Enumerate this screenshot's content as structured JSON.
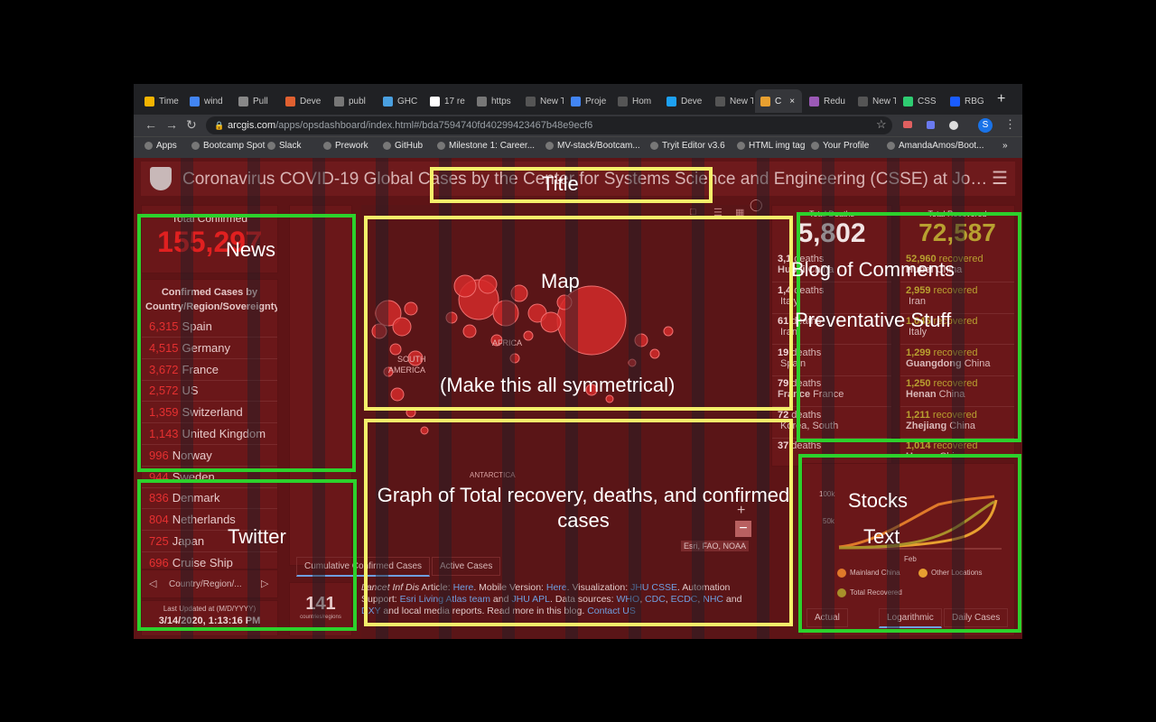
{
  "browser": {
    "tabs": [
      "Time",
      "wind",
      "Pull",
      "Deve",
      "publ",
      "GHC",
      "17 re",
      "https",
      "New Tab",
      "Proje",
      "Hom",
      "Deve",
      "New Tab",
      "C",
      "Redu",
      "New Tab",
      "CSS",
      "RBG"
    ],
    "url_host": "arcgis.com",
    "url_path": "/apps/opsdashboard/index.html#/bda7594740fd40299423467b48e9ecf6",
    "profile_initial": "S",
    "bookmarks": [
      "Apps",
      "Bootcamp Spot",
      "Slack",
      "Prework",
      "GitHub",
      "Milestone 1: Career...",
      "MV-stack/Bootcam...",
      "Tryit Editor v3.6",
      "HTML img tag",
      "Your Profile",
      "AmandaAmos/Boot..."
    ],
    "more": "»"
  },
  "dashboard": {
    "title": "Coronavirus COVID-19 Global Cases by the Center for Systems Science and Engineering (CSSE) at Jo…",
    "total_confirmed_label": "Total Confirmed",
    "total_confirmed_value": "155,297",
    "confirmed_list_header": "Confirmed Cases by Country/Region/Sovereignty",
    "confirmed_list": [
      {
        "n": "6,315",
        "c": "Spain"
      },
      {
        "n": "4,515",
        "c": "Germany"
      },
      {
        "n": "3,672",
        "c": "France"
      },
      {
        "n": "2,572",
        "c": "US"
      },
      {
        "n": "1,359",
        "c": "Switzerland"
      },
      {
        "n": "1,143",
        "c": "United Kingdom"
      },
      {
        "n": "996",
        "c": "Norway"
      },
      {
        "n": "944",
        "c": "Sweden"
      },
      {
        "n": "836",
        "c": "Denmark"
      },
      {
        "n": "804",
        "c": "Netherlands"
      },
      {
        "n": "725",
        "c": "Japan"
      },
      {
        "n": "696",
        "c": "Cruise Ship"
      }
    ],
    "pager_label": "Country/Region/...",
    "last_updated_label": "Last Updated at (M/D/YYYY)",
    "last_updated_value": "3/14/2020, 1:13:16 PM",
    "countries_count": "141",
    "countries_label": "countries/regions",
    "map_attribution": "Esri, FAO, NOAA",
    "map_labels": [
      "AFRICA",
      "SOUTH",
      "AMERICA",
      "ANTARCTICA"
    ],
    "map_tabs": [
      "Cumulative Confirmed Cases",
      "Active Cases"
    ],
    "info": {
      "p1": "Lancet Inf Dis",
      "p2": " Article: ",
      "here1": "Here",
      "p3": ". Mobile Version: ",
      "here2": "Here",
      "p4": ". Visualization: ",
      "jhu": "JHU CSSE",
      "p5": ". Automation Support: ",
      "esri": "Esri Living Atlas team",
      "p6": " and ",
      "apl": "JHU APL",
      "p7": ". Data sources: ",
      "who": "WHO",
      "cdc": "CDC",
      "ecdc": "ECDC",
      "nhc": "NHC",
      "dxy": "DXY",
      "p8": " and local media reports. Read more in this blog. ",
      "contact": "Contact US"
    },
    "total_deaths_label": "Total Deaths",
    "total_deaths_value": "5,802",
    "deaths_list": [
      {
        "n": "3,1",
        "l": "deaths",
        "p": "Hubei",
        "c": "China"
      },
      {
        "n": "1,4",
        "l": "deaths",
        "p": "",
        "c": "Italy"
      },
      {
        "n": "61",
        "l": "deaths",
        "p": "",
        "c": "Iran"
      },
      {
        "n": "19",
        "l": "deaths",
        "p": "",
        "c": "Spain"
      },
      {
        "n": "79",
        "l": "deaths",
        "p": "France",
        "c": "France"
      },
      {
        "n": "72",
        "l": "deaths",
        "p": "",
        "c": "Korea, South"
      },
      {
        "n": "37",
        "l": "deaths",
        "p": "",
        "c": ""
      }
    ],
    "total_recovered_label": "Total Recovered",
    "total_recovered_value": "72,587",
    "recovered_list": [
      {
        "n": "52,960",
        "l": "recovered",
        "p": "Hubei",
        "c": "China"
      },
      {
        "n": "2,959",
        "l": "recovered",
        "p": "",
        "c": "Iran"
      },
      {
        "n": "1,045",
        "l": "recovered",
        "p": "",
        "c": "Italy"
      },
      {
        "n": "1,299",
        "l": "recovered",
        "p": "Guangdong",
        "c": "China"
      },
      {
        "n": "1,250",
        "l": "recovered",
        "p": "Henan",
        "c": "China"
      },
      {
        "n": "1,211",
        "l": "recovered",
        "p": "Zhejiang",
        "c": "China"
      },
      {
        "n": "1,014",
        "l": "recovered",
        "p": "Hunan",
        "c": "China"
      }
    ],
    "chart_ticks": [
      "100k",
      "50k",
      "Feb"
    ],
    "legend": [
      "Mainland China",
      "Other Locations",
      "Total Recovered"
    ],
    "chart_tabs": [
      "Actual",
      "Logarithmic",
      "Daily Cases"
    ],
    "colors": {
      "mainland": "#e07a2a",
      "other": "#e8a030",
      "recovered": "#a8902a"
    }
  },
  "annotations": {
    "title": "Title",
    "news": "News",
    "map": "Map",
    "map_sub": "(Make this all symmetrical)",
    "comments": "Blog of Comments",
    "preventative": "Preventative Stuff",
    "twitter": "Twitter",
    "graph": "Graph of Total recovery, deaths, and confirmed cases",
    "stocks": "Stocks",
    "text": "Text"
  }
}
